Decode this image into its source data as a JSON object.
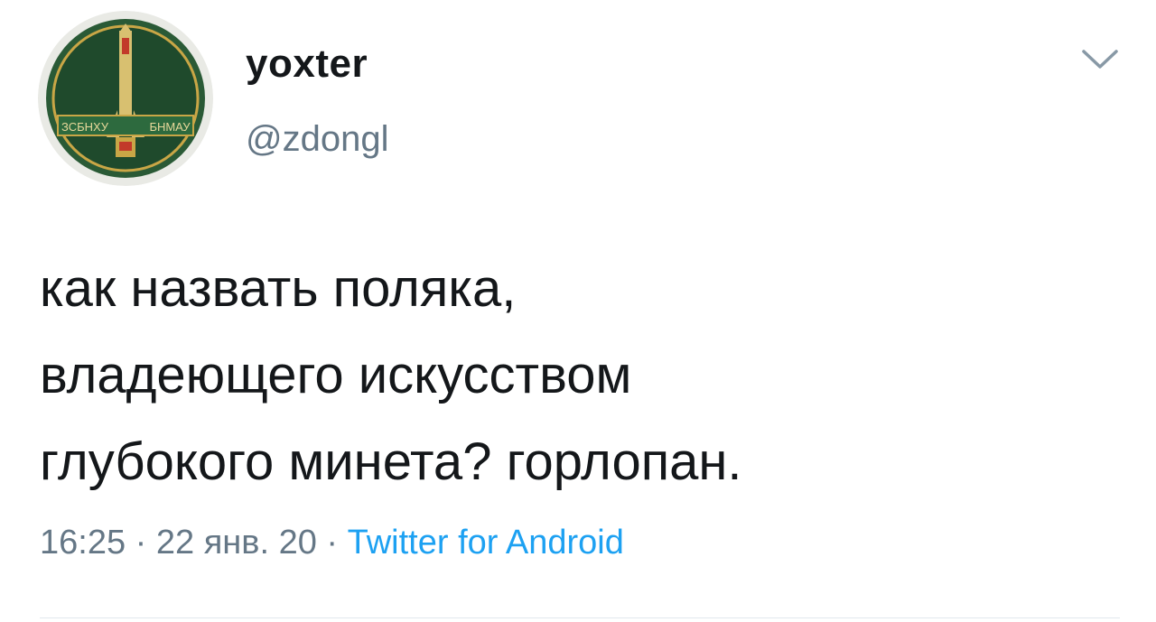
{
  "user": {
    "display_name": "yoxter",
    "handle": "@zdongl",
    "avatar_text_left": "ЗСБНХУ",
    "avatar_text_right": "БНМАУ"
  },
  "tweet": {
    "lines": [
      "как назвать поляка,",
      "владеющего искусством",
      "глубокого минета? горлопан."
    ]
  },
  "meta": {
    "time": "16:25",
    "separator": " · ",
    "date": "22 янв. 20",
    "source": "Twitter for Android"
  },
  "icons": {
    "menu": "chevron-down-icon"
  },
  "colors": {
    "text": "#14171a",
    "secondary": "#657786",
    "link": "#1da1f2",
    "avatar_green": "#1f4a2c"
  }
}
